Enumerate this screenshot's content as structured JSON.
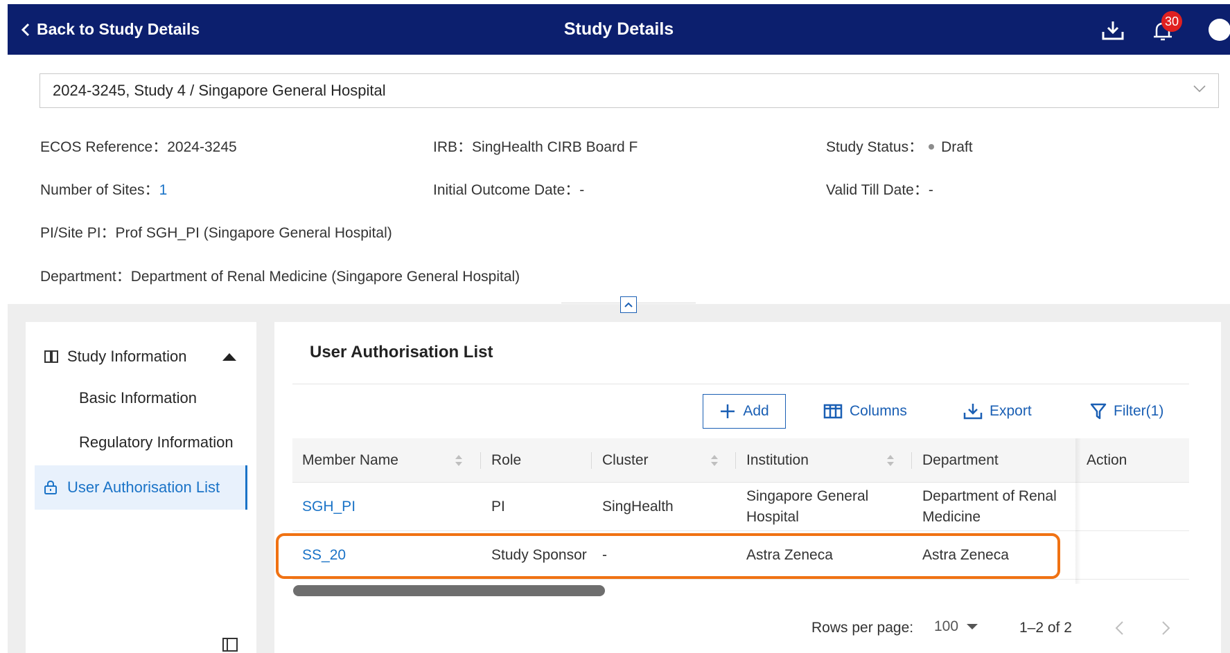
{
  "header": {
    "back_label": "Back to Study Details",
    "title": "Study Details",
    "notification_count": "30",
    "icons": [
      "chevron-left-icon",
      "download-icon",
      "bell-icon",
      "avatar"
    ]
  },
  "study_selector": {
    "value": "2024-3245, Study 4 / Singapore General Hospital"
  },
  "study_info": {
    "ecos_label": "ECOS Reference：",
    "ecos_value": "2024-3245",
    "irb_label": "IRB：",
    "irb_value": "SingHealth CIRB Board F",
    "status_label": "Study Status：",
    "status_value": "Draft",
    "sites_label": "Number of Sites：",
    "sites_value": "1",
    "outcome_label": "Initial Outcome Date：",
    "outcome_value": "-",
    "valid_label": "Valid Till Date：",
    "valid_value": "-",
    "pi_label": "PI/Site PI：",
    "pi_value": "Prof SGH_PI (Singapore General Hospital)",
    "dept_label": "Department：",
    "dept_value": "Department of Renal Medicine (Singapore General Hospital)"
  },
  "sidebar": {
    "group_label": "Study Information",
    "items": [
      {
        "label": "Basic Information"
      },
      {
        "label": "Regulatory Information"
      },
      {
        "label": "User Authorisation List",
        "active": true
      }
    ]
  },
  "panel": {
    "title": "User Authorisation List",
    "toolbar": {
      "add_label": "Add",
      "columns_label": "Columns",
      "export_label": "Export",
      "filter_label": "Filter(1)"
    },
    "columns": [
      "Member Name",
      "Role",
      "Cluster",
      "Institution",
      "Department",
      "Action"
    ],
    "rows": [
      {
        "member": "SGH_PI",
        "role": "PI",
        "cluster": "SingHealth",
        "institution_1": "Singapore General",
        "institution_2": "Hospital",
        "department_1": "Department of Renal",
        "department_2": "Medicine"
      },
      {
        "member": "SS_20",
        "role": "Study Sponsor",
        "cluster": "-",
        "institution": "Astra Zeneca",
        "department": "Astra Zeneca"
      }
    ],
    "pagination": {
      "rows_per_page_label": "Rows per page:",
      "rows_per_page_value": "100",
      "range": "1–2 of 2"
    }
  },
  "colors": {
    "header_bg": "#0c1f6e",
    "link": "#1a73c7",
    "highlight": "#f07213",
    "badge": "#e02020"
  }
}
